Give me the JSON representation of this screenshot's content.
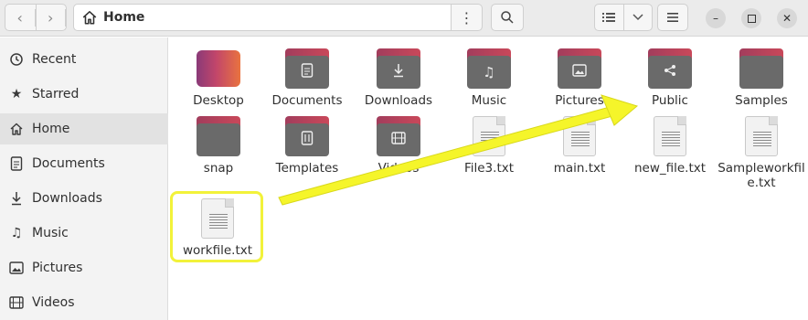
{
  "header": {
    "location_title": "Home",
    "icons": {
      "back": "chevron-left-icon",
      "forward": "chevron-right-icon",
      "home": "home-icon",
      "path_menu": "kebab-menu-icon",
      "search": "search-icon",
      "view_list": "list-view-icon",
      "view_dropdown": "chevron-down-icon",
      "app_menu": "hamburger-menu-icon",
      "minimize": "minimize-icon",
      "maximize": "maximize-icon",
      "close": "close-icon"
    }
  },
  "sidebar": {
    "items": [
      {
        "label": "Recent",
        "icon": "clock-icon"
      },
      {
        "label": "Starred",
        "icon": "star-icon"
      },
      {
        "label": "Home",
        "icon": "home-icon",
        "active": true
      },
      {
        "label": "Documents",
        "icon": "document-icon"
      },
      {
        "label": "Downloads",
        "icon": "download-icon"
      },
      {
        "label": "Music",
        "icon": "music-note-icon"
      },
      {
        "label": "Pictures",
        "icon": "image-icon"
      },
      {
        "label": "Videos",
        "icon": "film-icon"
      }
    ]
  },
  "files": [
    {
      "name": "Desktop",
      "type": "desktop-folder"
    },
    {
      "name": "Documents",
      "type": "folder",
      "emblem": "document-icon"
    },
    {
      "name": "Downloads",
      "type": "folder",
      "emblem": "download-icon"
    },
    {
      "name": "Music",
      "type": "folder",
      "emblem": "music-note-icon"
    },
    {
      "name": "Pictures",
      "type": "folder",
      "emblem": "image-icon"
    },
    {
      "name": "Public",
      "type": "folder",
      "emblem": "share-icon"
    },
    {
      "name": "Samples",
      "type": "folder"
    },
    {
      "name": "snap",
      "type": "folder"
    },
    {
      "name": "Templates",
      "type": "folder",
      "emblem": "template-icon"
    },
    {
      "name": "Videos",
      "type": "folder",
      "emblem": "film-icon"
    },
    {
      "name": "File3.txt",
      "type": "text-file"
    },
    {
      "name": "main.txt",
      "type": "text-file"
    },
    {
      "name": "new_file.txt",
      "type": "text-file"
    },
    {
      "name": "Sampleworkfile.txt",
      "type": "text-file"
    },
    {
      "name": "workfile.txt",
      "type": "text-file",
      "highlighted": true
    }
  ],
  "annotation": {
    "highlight_color": "#f2f23a",
    "arrow_color": "#f5f52a",
    "arrow_from": "workfile.txt",
    "arrow_to": "Public"
  }
}
